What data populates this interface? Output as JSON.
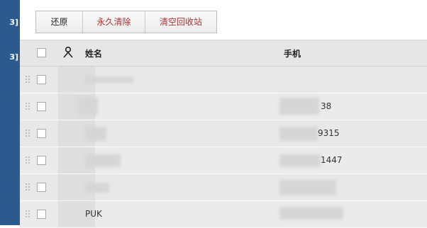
{
  "sidebar": {
    "labels": [
      "3]",
      "3]"
    ]
  },
  "toolbar": {
    "restore_label": "还原",
    "permanent_delete_label": "永久清除",
    "empty_recycle_label": "清空回收站"
  },
  "table": {
    "headers": {
      "name": "姓名",
      "phone": "手机"
    },
    "rows": [
      {
        "name": "",
        "phone": ""
      },
      {
        "name": "",
        "phone": "38"
      },
      {
        "name": "",
        "phone": "9315"
      },
      {
        "name": "",
        "phone": "1447"
      },
      {
        "name": "",
        "phone": ""
      },
      {
        "name": "PUK",
        "phone": ""
      }
    ]
  },
  "colors": {
    "sidebar": "#2b5a8e",
    "danger_text": "#aa3333",
    "header_bg": "#e6e6e6"
  },
  "icons": [
    "user-icon",
    "drag-handle-icon"
  ]
}
